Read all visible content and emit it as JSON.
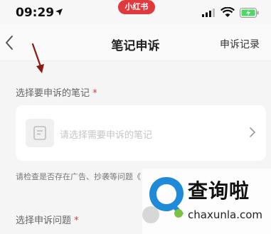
{
  "status_bar": {
    "time": "09:29",
    "app_pill": "小红书",
    "icons": [
      "location-arrow-icon",
      "signal-icon",
      "wifi-icon",
      "battery-charging-icon"
    ],
    "battery_color": "#4cd964"
  },
  "nav": {
    "back_icon": "chevron-left-icon",
    "title": "笔记申诉",
    "records": "申诉记录"
  },
  "section1": {
    "label": "选择要申诉的笔记",
    "required": "*"
  },
  "note_picker": {
    "icon": "note-icon",
    "placeholder": "请选择需要申诉的笔记",
    "chevron": "chevron-right-icon"
  },
  "hint": "请检查是否存在广告、抄袭等问题《",
  "section2": {
    "label": "选择申诉问题",
    "required": "*"
  },
  "watermark": {
    "title": "查询啦",
    "domain": "chaxunla.com"
  },
  "colors": {
    "accent": "#e0393e",
    "annotation_arrow": "#8b1a12",
    "watermark_blue": "#1e8ad8",
    "watermark_green": "#7cc242"
  }
}
